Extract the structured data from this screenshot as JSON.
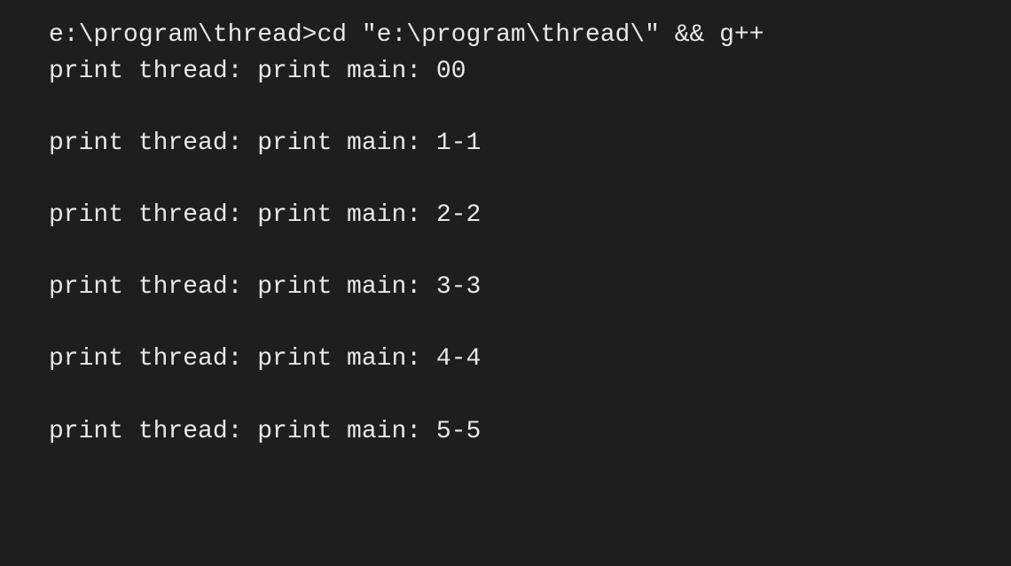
{
  "terminal": {
    "prompt": "e:\\program\\thread>cd \"e:\\program\\thread\\\" && g++ ",
    "lines": [
      "print thread: print main: 00",
      "",
      "print thread: print main: 1-1",
      "",
      "print thread: print main: 2-2",
      "",
      "print thread: print main: 3-3",
      "",
      "print thread: print main: 4-4",
      "",
      "print thread: print main: 5-5"
    ]
  }
}
